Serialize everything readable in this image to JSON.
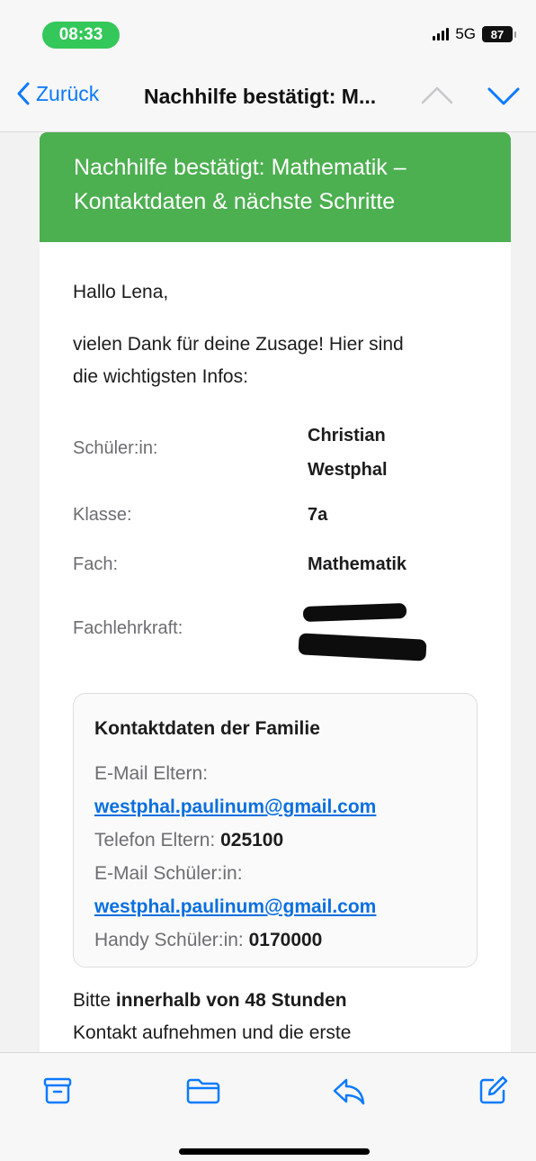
{
  "status_bar": {
    "time": "08:33",
    "network": "5G",
    "battery": "87"
  },
  "nav": {
    "back_label": "Zurück",
    "title": "Nachhilfe bestätigt: M..."
  },
  "email": {
    "header_line1": "Nachhilfe bestätigt: Mathematik –",
    "header_line2": "Kontaktdaten & nächste Schritte",
    "greeting": "Hallo Lena,",
    "intro_line1": "vielen Dank für deine Zusage! Hier sind",
    "intro_line2": "die wichtigsten Infos:",
    "details": [
      {
        "label": "Schüler:in:",
        "value_line1": "Christian",
        "value_line2": "Westphal"
      },
      {
        "label": "Klasse:",
        "value": "7a"
      },
      {
        "label": "Fach:",
        "value": "Mathematik"
      },
      {
        "label": "Fachlehrkraft:",
        "value": ""
      }
    ],
    "contact": {
      "title": "Kontaktdaten der Familie",
      "email_parents_label": "E-Mail Eltern:",
      "email_parents": "westphal.paulinum@gmail.com",
      "phone_parents_label": "Telefon Eltern:",
      "phone_parents": "025100",
      "email_student_label": "E-Mail Schüler:in:",
      "email_student": "westphal.paulinum@gmail.com",
      "mobile_student_label": "Handy Schüler:in:",
      "mobile_student": "0170000"
    },
    "closing_prefix": "Bitte",
    "closing_bold": "innerhalb von 48 Stunden",
    "closing_line2": "Kontakt aufnehmen und die erste"
  },
  "toolbar": {
    "icons": [
      "archive-icon",
      "folder-icon",
      "reply-icon",
      "compose-icon"
    ]
  },
  "colors": {
    "accent": "#0a7aff",
    "header_green": "#4caf50",
    "time_pill": "#34c759"
  }
}
